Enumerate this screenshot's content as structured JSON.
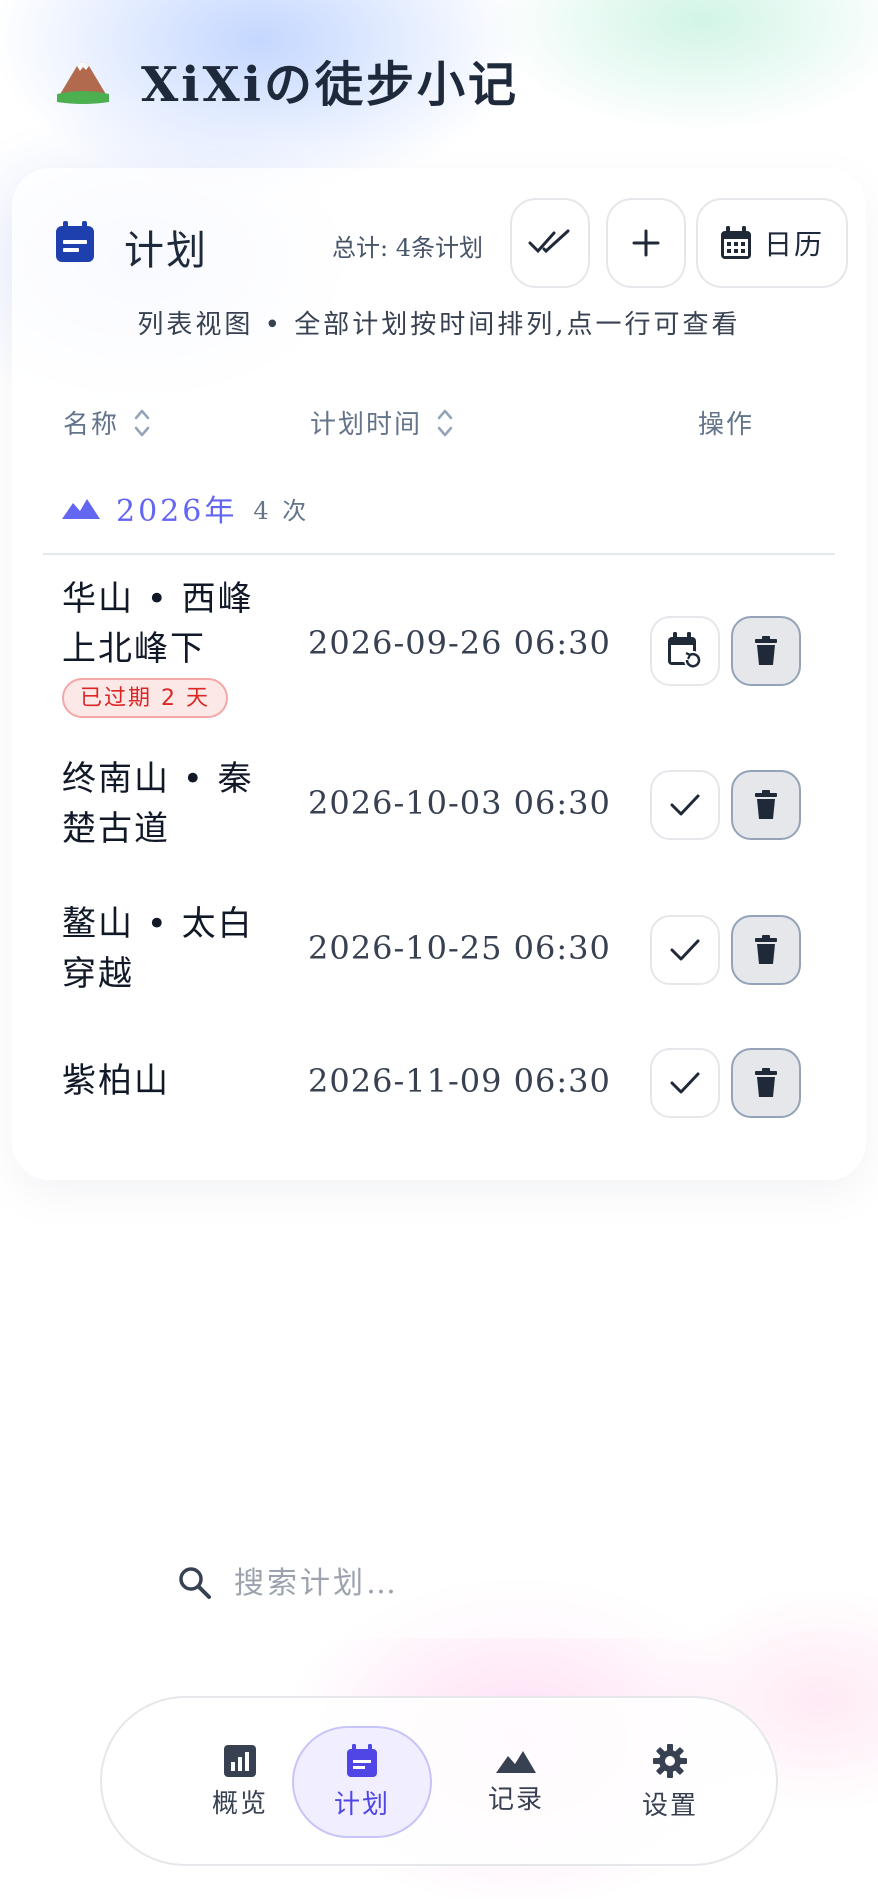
{
  "app": {
    "title": "XiXiの徒步小记"
  },
  "card": {
    "title": "计划",
    "total": "总计: 4条计划",
    "calendar_label": "日历",
    "subtitle": "列表视图 • 全部计划按时间排列,点一行可查看"
  },
  "table": {
    "headers": {
      "name": "名称",
      "time": "计划时间",
      "op": "操作"
    },
    "group": {
      "year": "2026年",
      "count": "4 次"
    },
    "rows": [
      {
        "name": "华山 • 西峰上北峰下",
        "time": "2026-09-26 06:30",
        "badge": "已过期 2 天",
        "action_icon": "calendar-restore-icon"
      },
      {
        "name": "终南山 • 秦楚古道",
        "time": "2026-10-03 06:30",
        "action_icon": "check-icon"
      },
      {
        "name": "鳌山 • 太白穿越",
        "time": "2026-10-25 06:30",
        "action_icon": "check-icon"
      },
      {
        "name": "紫柏山",
        "time": "2026-11-09 06:30",
        "action_icon": "check-icon"
      }
    ]
  },
  "search": {
    "placeholder": "搜索计划…",
    "value": ""
  },
  "nav": {
    "items": [
      {
        "label": "概览",
        "icon": "chart-icon"
      },
      {
        "label": "计划",
        "icon": "calendar-icon",
        "active": true
      },
      {
        "label": "记录",
        "icon": "mountain-icon"
      },
      {
        "label": "设置",
        "icon": "gear-icon"
      }
    ]
  },
  "colors": {
    "accent": "#6366f1",
    "primary_icon": "#1e40af",
    "expired": "#dc2626"
  }
}
